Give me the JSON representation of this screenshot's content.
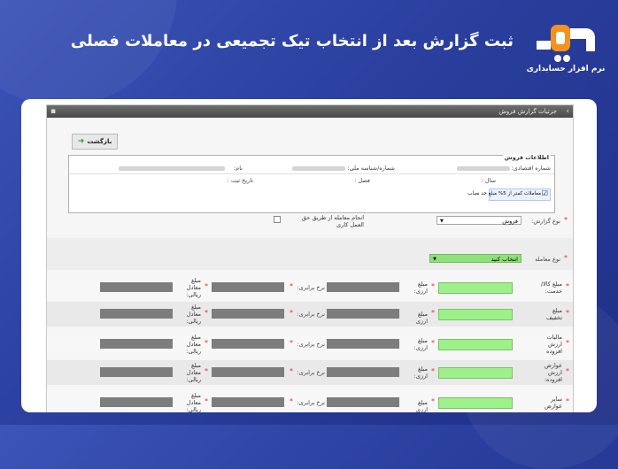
{
  "hero": {
    "title": "ثبت گزارش بعد از انتخاب تیک تجمیعی در معاملات فصلی",
    "logo_text": "نرم افزار حسابداری",
    "brand_colors": {
      "orange": "#f5921e",
      "blue": "#2f4bb5",
      "white": "#ffffff"
    }
  },
  "window": {
    "title": "جزئیات گزارش فروش",
    "back_label": "بازگشت",
    "info": {
      "legend": "اطلاعات فروش",
      "economic_code_label": "شماره اقتصادی:",
      "national_id_label": "شماره/شناسه ملی:",
      "name_label": "نام:",
      "year_label": "سال :",
      "season_label": "فصل :",
      "record_date_label": "تاریخ ثبت :",
      "aggregate_checkbox_label": "معاملات کمتر از 5% مبلغ حد نصاب",
      "aggregate_checked": true
    },
    "report_type": {
      "label": "نوع گزارش:",
      "value": "فروش"
    },
    "agent_checkbox_label": "انجام معامله از طریق حق العمل کاری",
    "deal_type": {
      "label": "نوع معامله",
      "value": "انتخاب کنید"
    },
    "rows": [
      {
        "label": "مبلغ کالا/ خدمت:",
        "right_sub": "مبلغ ارزی:"
      },
      {
        "label": "مبلغ تخفیف",
        "right_sub": "مبلغ ارزی"
      },
      {
        "label": "مالیات ارزش افزوده",
        "right_sub": "مبلغ ارزی:"
      },
      {
        "label": "عوارض ارزش افزوده:",
        "right_sub": "مبلغ ارزی:"
      },
      {
        "label": "سایر عوارض",
        "right_sub": "مبلغ ارزی"
      }
    ],
    "rate_label": "نرخ برابری:",
    "rial_label": "مبلغ معادل ریالی:"
  }
}
